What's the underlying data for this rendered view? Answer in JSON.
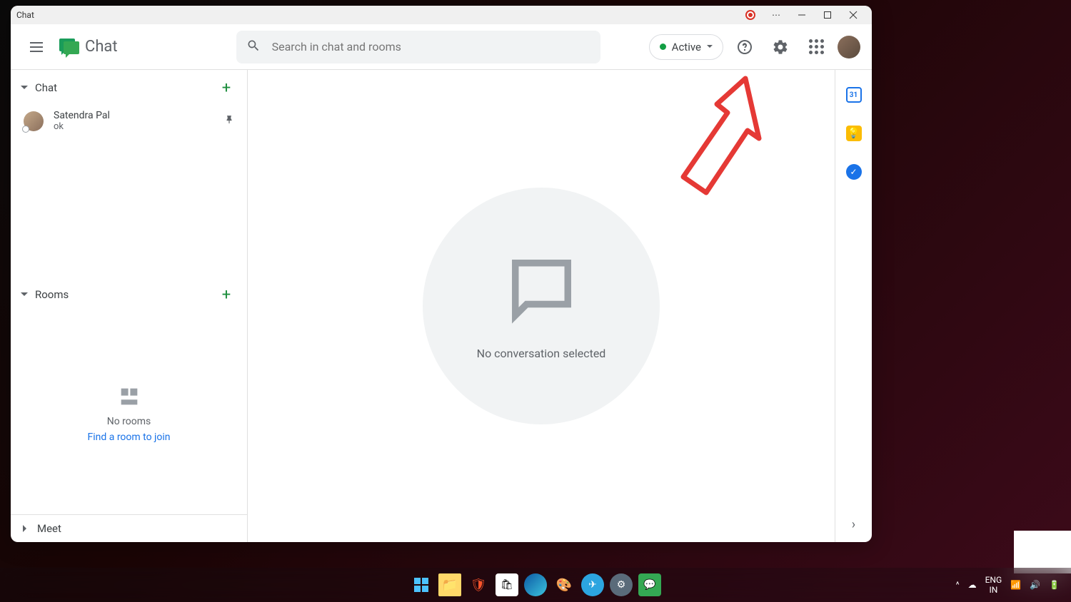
{
  "window": {
    "title": "Chat"
  },
  "header": {
    "logo_text": "Chat",
    "search": {
      "placeholder": "Search in chat and rooms"
    },
    "status": "Active"
  },
  "sidebar": {
    "chat": {
      "label": "Chat",
      "items": [
        {
          "name": "Satendra Pal",
          "preview": "ok"
        }
      ]
    },
    "rooms": {
      "label": "Rooms",
      "empty_text": "No rooms",
      "link_text": "Find a room to join"
    },
    "meet": {
      "label": "Meet"
    }
  },
  "main": {
    "empty_text": "No conversation selected"
  },
  "sidepanel": {
    "calendar_day": "31"
  },
  "taskbar": {
    "lang1": "ENG",
    "lang2": "IN"
  }
}
